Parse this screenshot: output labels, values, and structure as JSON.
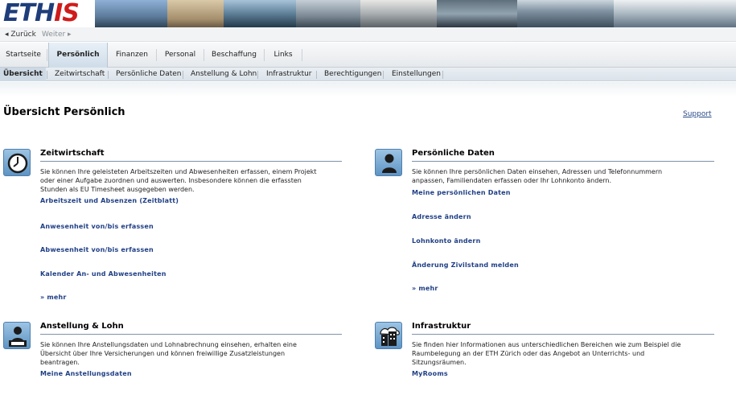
{
  "header": {
    "logo_eth": "ETH",
    "logo_is": "IS"
  },
  "nav": {
    "back": "◂ Zurück",
    "forward": "Weiter ▸"
  },
  "tabs": [
    {
      "label": "Startseite"
    },
    {
      "label": "Persönlich"
    },
    {
      "label": "Finanzen"
    },
    {
      "label": "Personal"
    },
    {
      "label": "Beschaffung"
    },
    {
      "label": "Links"
    }
  ],
  "subtabs": [
    {
      "label": "Übersicht"
    },
    {
      "label": "Zeitwirtschaft"
    },
    {
      "label": "Persönliche Daten"
    },
    {
      "label": "Anstellung & Lohn"
    },
    {
      "label": "Infrastruktur"
    },
    {
      "label": "Berechtigungen"
    },
    {
      "label": "Einstellungen"
    }
  ],
  "page": {
    "title": "Übersicht Persönlich",
    "support": "Support"
  },
  "sections": {
    "zeitwirtschaft": {
      "title": "Zeitwirtschaft",
      "desc": [
        "Sie können Ihre geleisteten Arbeitszeiten und Abwesenheiten erfassen, einem Projekt",
        "oder einer Aufgabe zuordnen und auswerten. Insbesondere können die erfassten",
        "Stunden als EU Timesheet ausgegeben werden."
      ],
      "links": [
        "Arbeitszeit und Absenzen (Zeitblatt)",
        "Anwesenheit von/bis erfassen",
        "Abwesenheit von/bis erfassen",
        "Kalender An- und Abwesenheiten",
        "» mehr"
      ]
    },
    "persoenliche_daten": {
      "title": "Persönliche Daten",
      "desc": [
        "Sie können Ihre persönlichen Daten einsehen, Adressen und Telefonnummern",
        "anpassen, Familiendaten erfassen oder Ihr Lohnkonto ändern."
      ],
      "links": [
        "Meine persönlichen Daten",
        "Adresse ändern",
        "Lohnkonto ändern",
        "Änderung Zivilstand melden",
        "» mehr"
      ]
    },
    "anstellung": {
      "title": "Anstellung & Lohn",
      "desc": [
        "Sie können Ihre Anstellungsdaten und Lohnabrechnung einsehen, erhalten eine",
        "Übersicht über Ihre Versicherungen und können freiwillige Zusatzleistungen",
        "beantragen."
      ],
      "links": [
        "Meine Anstellungsdaten"
      ]
    },
    "infrastruktur": {
      "title": "Infrastruktur",
      "desc": [
        "Sie finden hier Informationen  aus unterschiedlichen Bereichen wie zum Beispiel die",
        "Raumbelegung an der ETH Zürich oder das Angebot an Unterrichts- und",
        "Sitzungsräumen."
      ],
      "links": [
        "MyRooms"
      ]
    }
  },
  "icons": {
    "zeitwirtschaft": "clock-icon",
    "persoenliche_daten": "person-icon",
    "anstellung": "employee-icon",
    "infrastruktur": "building-icon"
  },
  "colors": {
    "link": "#1f3f85",
    "logo_eth": "#1f3d7a",
    "logo_is": "#d01b1b"
  }
}
